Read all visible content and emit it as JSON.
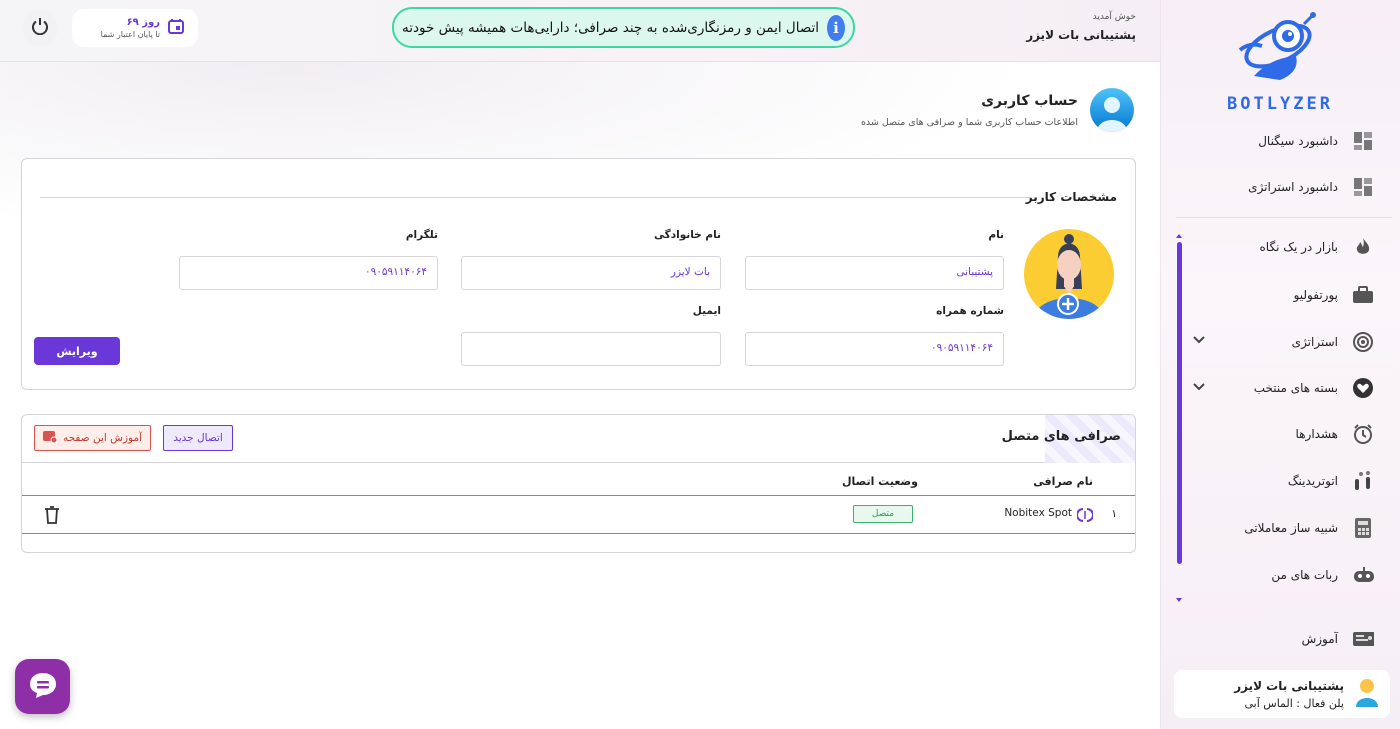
{
  "brand": {
    "logo_text": "BOTLYZER"
  },
  "topbar": {
    "welcome_small": "خوش آمدید",
    "welcome_name": "پشتیبانی بات لایزر",
    "announcement": "اتصال ایمن و رمزنگاری‌شده به چند صرافی؛ دارایی‌هات همیشه پیش خودته",
    "credit_days": "۶۹ روز",
    "credit_sub": "تا پایان اعتبار شما"
  },
  "sidebar": {
    "items": [
      {
        "label": "داشبورد سیگنال",
        "icon": "dashboard-icon"
      },
      {
        "label": "داشبورد استراتژی",
        "icon": "dashboard-icon"
      },
      {
        "label": "بازار در یک نگاه",
        "icon": "flame-icon"
      },
      {
        "label": "پورتفولیو",
        "icon": "briefcase-icon"
      },
      {
        "label": "استراتژی",
        "icon": "target-icon"
      },
      {
        "label": "بسته های منتخب",
        "icon": "heart-icon"
      },
      {
        "label": "هشدارها",
        "icon": "alarm-icon"
      },
      {
        "label": "اتوتریدینگ",
        "icon": "autotrading-icon"
      },
      {
        "label": "شبیه ساز معاملاتی",
        "icon": "calculator-icon"
      },
      {
        "label": "ربات های من",
        "icon": "robot-icon"
      },
      {
        "label": "آموزش",
        "icon": "education-icon"
      }
    ],
    "user": {
      "name": "پشتیبانی بات لایزر",
      "plan": "پلن فعال : الماس آبی"
    }
  },
  "page": {
    "title": "حساب کاربری",
    "subtitle": "اطلاعات حساب کاربری شما و صرافی های متصل شده"
  },
  "profile": {
    "section_title": "مشخصات کاربر",
    "fields": {
      "first_name_label": "نام",
      "first_name_value": "پشتیبانی",
      "last_name_label": "نام خانوادگی",
      "last_name_value": "بات لایزر",
      "telegram_label": "تلگرام",
      "telegram_value": "۰۹۰۵۹۱۱۴۰۶۴",
      "mobile_label": "شماره همراه",
      "mobile_value": "۰۹۰۵۹۱۱۴۰۶۴",
      "email_label": "ایمیل",
      "email_value": ""
    },
    "edit_label": "ویرایش"
  },
  "exchanges": {
    "title": "صرافی های متصل",
    "new_connection_label": "اتصال جدید",
    "tutorial_label": "آموزش این صفحه",
    "columns": [
      "نام صرافی",
      "وضعیت اتصال"
    ],
    "rows": [
      {
        "index": "۱",
        "name": "Nobitex Spot",
        "status": "متصل"
      }
    ]
  },
  "colors": {
    "accent": "#6a37d8",
    "success": "#3ab36a",
    "info": "#3fd6a4"
  }
}
